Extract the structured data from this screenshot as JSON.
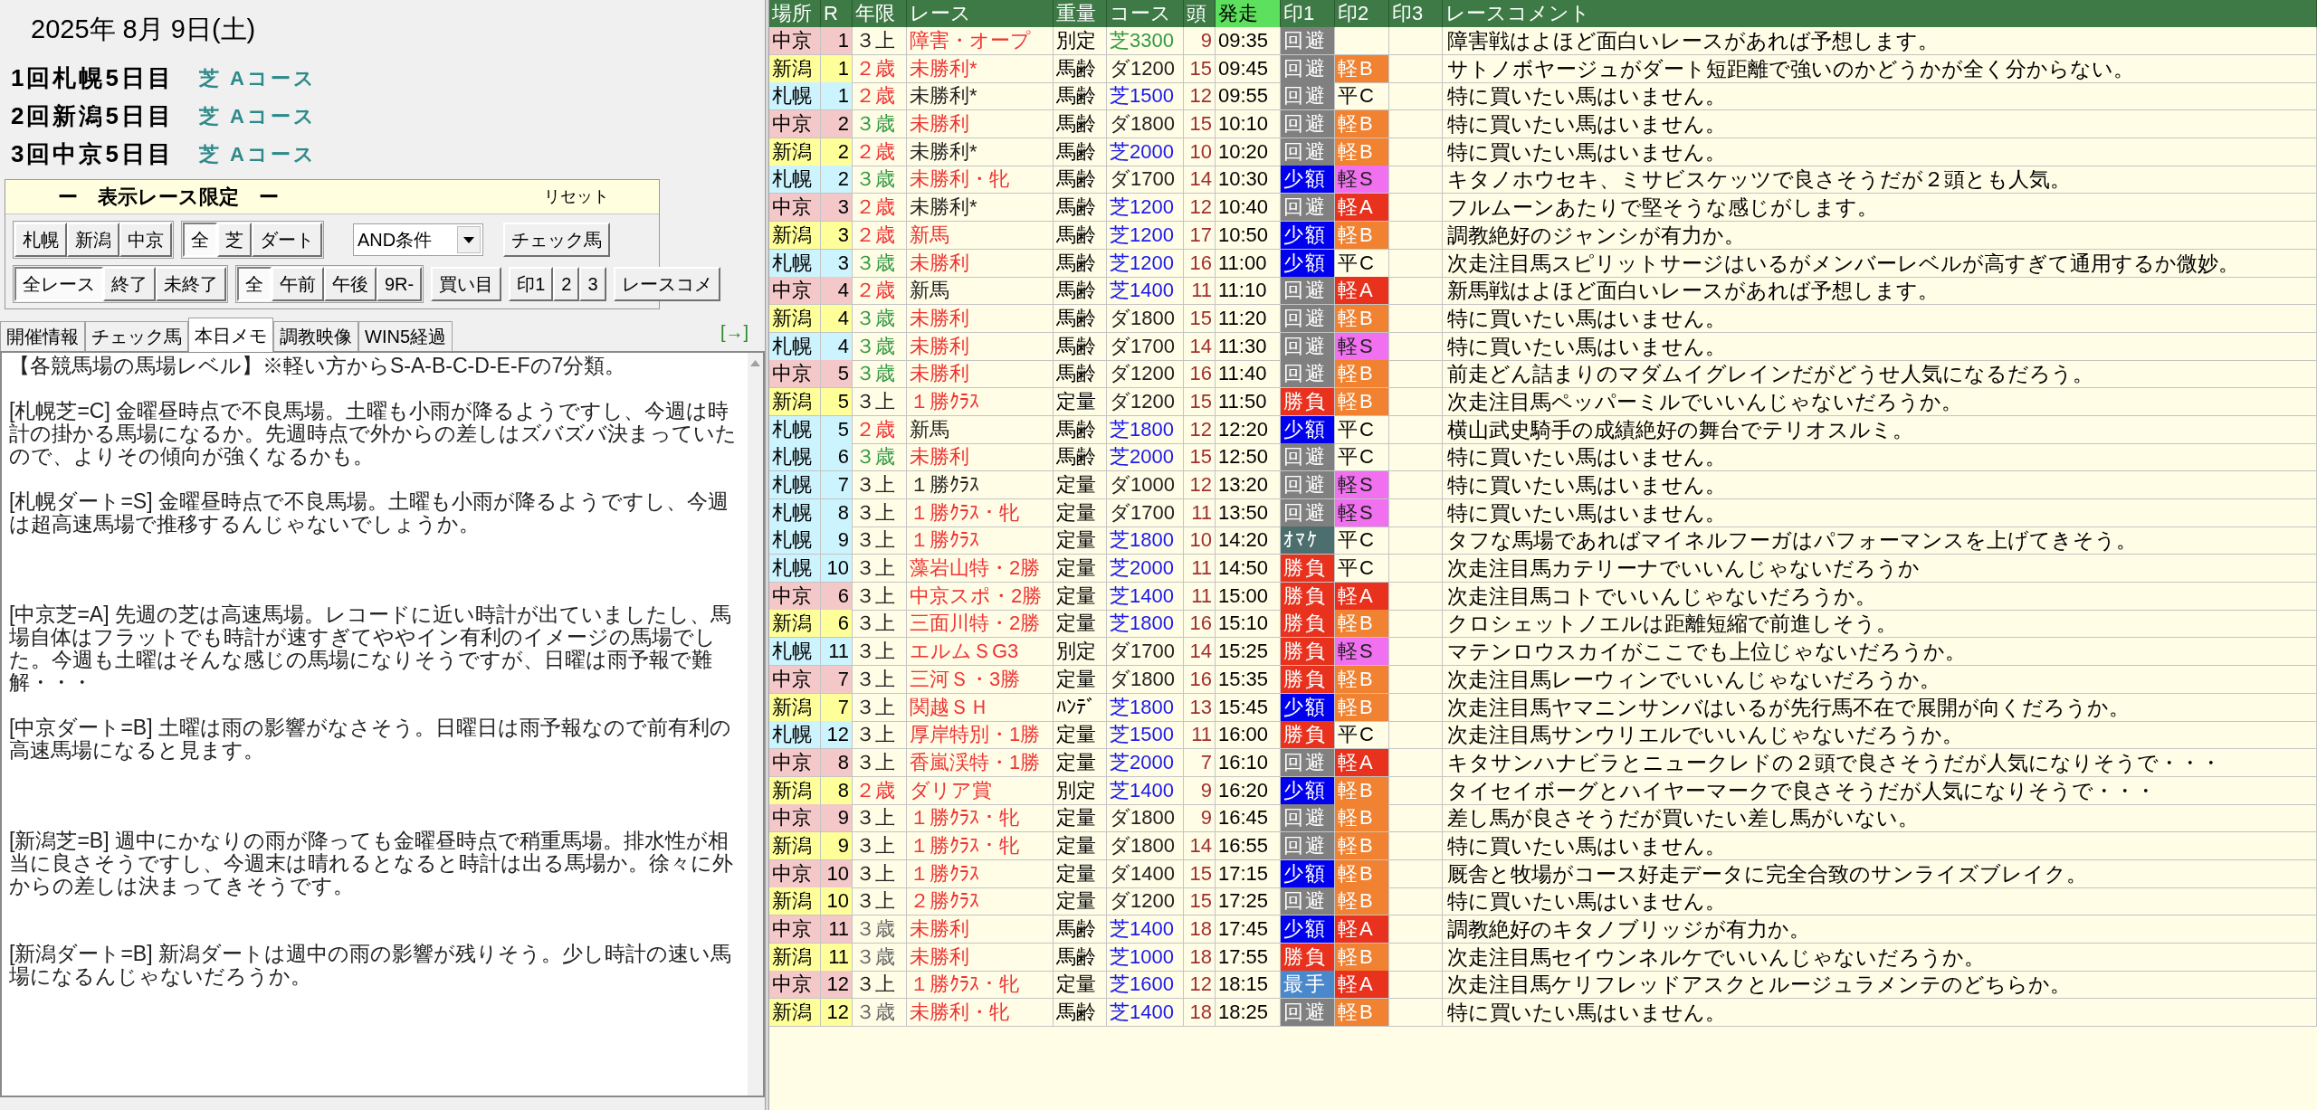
{
  "date": "2025年 8月 9日(土)",
  "meetings": [
    {
      "name": "1回札幌5日目",
      "course": "芝 Aコース"
    },
    {
      "name": "2回新潟5日目",
      "course": "芝 Aコース"
    },
    {
      "name": "3回中京5日目",
      "course": "芝 Aコース"
    }
  ],
  "filter": {
    "title": "ー　表示レース限定　ー",
    "reset": "リセット",
    "venue_buttons": [
      {
        "label": "札幌",
        "selected": false
      },
      {
        "label": "新潟",
        "selected": false
      },
      {
        "label": "中京",
        "selected": false
      }
    ],
    "surface_buttons": [
      {
        "label": "全",
        "selected": true
      },
      {
        "label": "芝",
        "selected": false
      },
      {
        "label": "ダート",
        "selected": false
      }
    ],
    "condition": "AND条件",
    "check_button": "チェック馬",
    "status_buttons": [
      {
        "label": "全レース",
        "selected": true
      },
      {
        "label": "終了",
        "selected": false
      },
      {
        "label": "未終了",
        "selected": false
      }
    ],
    "time_buttons": [
      {
        "label": "全",
        "selected": true
      },
      {
        "label": "午前",
        "selected": false
      },
      {
        "label": "午後",
        "selected": false
      },
      {
        "label": "9R-",
        "selected": false
      }
    ],
    "buy_button": "買い目",
    "mark_buttons": [
      "印1",
      "2",
      "3"
    ],
    "comment_button": "レースコメ"
  },
  "tabs": [
    {
      "label": "開催情報",
      "selected": false
    },
    {
      "label": "チェック馬",
      "selected": false
    },
    {
      "label": "本日メモ",
      "selected": true
    },
    {
      "label": "調教映像",
      "selected": false
    },
    {
      "label": "WIN5経過",
      "selected": false
    }
  ],
  "expand_link": "[→]",
  "memo": "【各競馬場の馬場レベル】※軽い方からS-A-B-C-D-E-Fの7分類。\n\n[札幌芝=C] 金曜昼時点で不良馬場。土曜も小雨が降るようですし、今週は時計の掛かる馬場になるか。先週時点で外からの差しはズバズバ決まっていたので、よりその傾向が強くなるかも。\n\n[札幌ダート=S] 金曜昼時点で不良馬場。土曜も小雨が降るようですし、今週は超高速馬場で推移するんじゃないでしょうか。\n\n\n\n[中京芝=A] 先週の芝は高速馬場。レコードに近い時計が出ていましたし、馬場自体はフラットでも時計が速すぎてややイン有利のイメージの馬場でした。今週も土曜はそんな感じの馬場になりそうですが、日曜は雨予報で難解・・・\n\n[中京ダート=B] 土曜は雨の影響がなさそう。日曜日は雨予報なので前有利の高速馬場になると見ます。\n\n\n\n[新潟芝=B] 週中にかなりの雨が降っても金曜昼時点で稍重馬場。排水性が相当に良さそうですし、今週末は晴れるとなると時計は出る馬場か。徐々に外からの差しは決まってきそうです。\n\n\n[新潟ダート=B] 新潟ダートは週中の雨の影響が残りそう。少し時計の速い馬場になるんじゃないだろうか。",
  "table": {
    "columns": [
      {
        "label": "場所",
        "highlighted": false
      },
      {
        "label": "R",
        "highlighted": false
      },
      {
        "label": "年限",
        "highlighted": false
      },
      {
        "label": "レース",
        "highlighted": false
      },
      {
        "label": "重量",
        "highlighted": false
      },
      {
        "label": "コース",
        "highlighted": false
      },
      {
        "label": "頭",
        "highlighted": false
      },
      {
        "label": "発走",
        "highlighted": true
      },
      {
        "label": "印1",
        "highlighted": false
      },
      {
        "label": "印2",
        "highlighted": false
      },
      {
        "label": "印3",
        "highlighted": false
      },
      {
        "label": "レースコメント",
        "highlighted": false
      }
    ],
    "rows": [
      {
        "venue": {
          "text": "中京",
          "color": "#f4c8c8"
        },
        "r": "1",
        "age": {
          "text": "３上",
          "color": "#222222"
        },
        "race": {
          "text": "障害・オープ",
          "color": "#ee3333"
        },
        "weight": "別定",
        "course": {
          "text": "芝3300",
          "color": "#339944"
        },
        "heads": "9",
        "start": "09:35",
        "mark1": {
          "text": "回避",
          "color": "#808080"
        },
        "comment": "障害戦はよほど面白いレースがあれば予想します。"
      },
      {
        "venue": {
          "text": "新潟",
          "color": "#ffff99"
        },
        "r": "1",
        "age": {
          "text": "２歳",
          "color": "#ee3333"
        },
        "race": {
          "text": "未勝利*",
          "color": "#ee3333"
        },
        "weight": "馬齢",
        "course": {
          "text": "ダ1200",
          "color": "#222222"
        },
        "heads": "15",
        "start": "09:45",
        "mark1": {
          "text": "回避",
          "color": "#808080"
        },
        "mark2": {
          "text": "軽B",
          "color": "#f08232"
        },
        "comment": "サトノボヤージュがダート短距離で強いのかどうかが全く分からない。"
      },
      {
        "venue": {
          "text": "札幌",
          "color": "#ccf4ff"
        },
        "r": "1",
        "age": {
          "text": "２歳",
          "color": "#ee3333"
        },
        "race": {
          "text": "未勝利*",
          "color": "#222222"
        },
        "weight": "馬齢",
        "course": {
          "text": "芝1500",
          "color": "#1a1aee"
        },
        "heads": "12",
        "start": "09:55",
        "mark1": {
          "text": "回避",
          "color": "#808080"
        },
        "mark2": {
          "text": "平C"
        },
        "comment": "特に買いたい馬はいません。"
      },
      {
        "venue": {
          "text": "中京",
          "color": "#f4c8c8"
        },
        "r": "2",
        "age": {
          "text": "３歳",
          "color": "#339944"
        },
        "race": {
          "text": "未勝利",
          "color": "#ee3333"
        },
        "weight": "馬齢",
        "course": {
          "text": "ダ1800",
          "color": "#222222"
        },
        "heads": "15",
        "start": "10:10",
        "mark1": {
          "text": "回避",
          "color": "#808080"
        },
        "mark2": {
          "text": "軽B",
          "color": "#f08232"
        },
        "comment": "特に買いたい馬はいません。"
      },
      {
        "venue": {
          "text": "新潟",
          "color": "#ffff99"
        },
        "r": "2",
        "age": {
          "text": "２歳",
          "color": "#ee3333"
        },
        "race": {
          "text": "未勝利*",
          "color": "#222222"
        },
        "weight": "馬齢",
        "course": {
          "text": "芝2000",
          "color": "#1a1aee"
        },
        "heads": "10",
        "start": "10:20",
        "mark1": {
          "text": "回避",
          "color": "#808080"
        },
        "mark2": {
          "text": "軽B",
          "color": "#f08232"
        },
        "comment": "特に買いたい馬はいません。"
      },
      {
        "venue": {
          "text": "札幌",
          "color": "#ccf4ff"
        },
        "r": "2",
        "age": {
          "text": "３歳",
          "color": "#339944"
        },
        "race": {
          "text": "未勝利・牝",
          "color": "#ee3333"
        },
        "weight": "馬齢",
        "course": {
          "text": "ダ1700",
          "color": "#222222"
        },
        "heads": "14",
        "start": "10:30",
        "mark1": {
          "text": "少額",
          "color": "#0000ee"
        },
        "mark2": {
          "text": "軽S",
          "color": "#f070f0"
        },
        "comment": "キタノホウセキ、ミサビスケッツで良さそうだが２頭とも人気。"
      },
      {
        "venue": {
          "text": "中京",
          "color": "#f4c8c8"
        },
        "r": "3",
        "age": {
          "text": "２歳",
          "color": "#ee3333"
        },
        "race": {
          "text": "未勝利*",
          "color": "#222222"
        },
        "weight": "馬齢",
        "course": {
          "text": "芝1200",
          "color": "#1a1aee"
        },
        "heads": "12",
        "start": "10:40",
        "mark1": {
          "text": "回避",
          "color": "#808080"
        },
        "mark2": {
          "text": "軽A",
          "color": "#e8321e"
        },
        "comment": "フルムーンあたりで堅そうな感じがします。"
      },
      {
        "venue": {
          "text": "新潟",
          "color": "#ffff99"
        },
        "r": "3",
        "age": {
          "text": "２歳",
          "color": "#ee3333"
        },
        "race": {
          "text": "新馬",
          "color": "#ee3333"
        },
        "weight": "馬齢",
        "course": {
          "text": "芝1200",
          "color": "#1a1aee"
        },
        "heads": "17",
        "start": "10:50",
        "mark1": {
          "text": "少額",
          "color": "#0000ee"
        },
        "mark2": {
          "text": "軽B",
          "color": "#f08232"
        },
        "comment": "調教絶好のジャンシが有力か。"
      },
      {
        "venue": {
          "text": "札幌",
          "color": "#ccf4ff"
        },
        "r": "3",
        "age": {
          "text": "３歳",
          "color": "#339944"
        },
        "race": {
          "text": "未勝利",
          "color": "#ee3333"
        },
        "weight": "馬齢",
        "course": {
          "text": "芝1200",
          "color": "#1a1aee"
        },
        "heads": "16",
        "start": "11:00",
        "mark1": {
          "text": "少額",
          "color": "#0000ee"
        },
        "mark2": {
          "text": "平C"
        },
        "comment": "次走注目馬スピリットサージはいるがメンバーレベルが高すぎて通用するか微妙。"
      },
      {
        "venue": {
          "text": "中京",
          "color": "#f4c8c8"
        },
        "r": "4",
        "age": {
          "text": "２歳",
          "color": "#ee3333"
        },
        "race": {
          "text": "新馬",
          "color": "#222222"
        },
        "weight": "馬齢",
        "course": {
          "text": "芝1400",
          "color": "#1a1aee"
        },
        "heads": "11",
        "start": "11:10",
        "mark1": {
          "text": "回避",
          "color": "#808080"
        },
        "mark2": {
          "text": "軽A",
          "color": "#e8321e"
        },
        "comment": "新馬戦はよほど面白いレースがあれば予想します。"
      },
      {
        "venue": {
          "text": "新潟",
          "color": "#ffff99"
        },
        "r": "4",
        "age": {
          "text": "３歳",
          "color": "#339944"
        },
        "race": {
          "text": "未勝利",
          "color": "#ee3333"
        },
        "weight": "馬齢",
        "course": {
          "text": "ダ1800",
          "color": "#222222"
        },
        "heads": "15",
        "start": "11:20",
        "mark1": {
          "text": "回避",
          "color": "#808080"
        },
        "mark2": {
          "text": "軽B",
          "color": "#f08232"
        },
        "comment": "特に買いたい馬はいません。"
      },
      {
        "venue": {
          "text": "札幌",
          "color": "#ccf4ff"
        },
        "r": "4",
        "age": {
          "text": "３歳",
          "color": "#339944"
        },
        "race": {
          "text": "未勝利",
          "color": "#ee3333"
        },
        "weight": "馬齢",
        "course": {
          "text": "ダ1700",
          "color": "#222222"
        },
        "heads": "14",
        "start": "11:30",
        "mark1": {
          "text": "回避",
          "color": "#808080"
        },
        "mark2": {
          "text": "軽S",
          "color": "#f070f0"
        },
        "comment": "特に買いたい馬はいません。"
      },
      {
        "venue": {
          "text": "中京",
          "color": "#f4c8c8"
        },
        "r": "5",
        "age": {
          "text": "３歳",
          "color": "#339944"
        },
        "race": {
          "text": "未勝利",
          "color": "#ee3333"
        },
        "weight": "馬齢",
        "course": {
          "text": "ダ1200",
          "color": "#222222"
        },
        "heads": "16",
        "start": "11:40",
        "mark1": {
          "text": "回避",
          "color": "#808080"
        },
        "mark2": {
          "text": "軽B",
          "color": "#f08232"
        },
        "comment": "前走どん詰まりのマダムイグレインだがどうせ人気になるだろう。"
      },
      {
        "venue": {
          "text": "新潟",
          "color": "#ffff99"
        },
        "r": "5",
        "age": {
          "text": "３上",
          "color": "#222222"
        },
        "race": {
          "text": "１勝ｸﾗｽ",
          "color": "#ee3333"
        },
        "weight": "定量",
        "course": {
          "text": "ダ1200",
          "color": "#222222"
        },
        "heads": "15",
        "start": "11:50",
        "mark1": {
          "text": "勝負",
          "color": "#e8321e"
        },
        "mark2": {
          "text": "軽B",
          "color": "#f08232"
        },
        "comment": "次走注目馬ペッパーミルでいいんじゃないだろうか。"
      },
      {
        "venue": {
          "text": "札幌",
          "color": "#ccf4ff"
        },
        "r": "5",
        "age": {
          "text": "２歳",
          "color": "#ee3333"
        },
        "race": {
          "text": "新馬",
          "color": "#222222"
        },
        "weight": "馬齢",
        "course": {
          "text": "芝1800",
          "color": "#1a1aee"
        },
        "heads": "12",
        "start": "12:20",
        "mark1": {
          "text": "少額",
          "color": "#0000ee"
        },
        "mark2": {
          "text": "平C"
        },
        "comment": "横山武史騎手の成績絶好の舞台でテリオスルミ。"
      },
      {
        "venue": {
          "text": "札幌",
          "color": "#ccf4ff"
        },
        "r": "6",
        "age": {
          "text": "３歳",
          "color": "#339944"
        },
        "race": {
          "text": "未勝利",
          "color": "#ee3333"
        },
        "weight": "馬齢",
        "course": {
          "text": "芝2000",
          "color": "#1a1aee"
        },
        "heads": "15",
        "start": "12:50",
        "mark1": {
          "text": "回避",
          "color": "#808080"
        },
        "mark2": {
          "text": "平C"
        },
        "comment": "特に買いたい馬はいません。"
      },
      {
        "venue": {
          "text": "札幌",
          "color": "#ccf4ff"
        },
        "r": "7",
        "age": {
          "text": "３上",
          "color": "#222222"
        },
        "race": {
          "text": "１勝ｸﾗｽ",
          "color": "#222222"
        },
        "weight": "定量",
        "course": {
          "text": "ダ1000",
          "color": "#222222"
        },
        "heads": "12",
        "start": "13:20",
        "mark1": {
          "text": "回避",
          "color": "#808080"
        },
        "mark2": {
          "text": "軽S",
          "color": "#f070f0"
        },
        "comment": "特に買いたい馬はいません。"
      },
      {
        "venue": {
          "text": "札幌",
          "color": "#ccf4ff"
        },
        "r": "8",
        "age": {
          "text": "３上",
          "color": "#222222"
        },
        "race": {
          "text": "１勝ｸﾗｽ・牝",
          "color": "#ee3333"
        },
        "weight": "定量",
        "course": {
          "text": "ダ1700",
          "color": "#222222"
        },
        "heads": "11",
        "start": "13:50",
        "mark1": {
          "text": "回避",
          "color": "#808080"
        },
        "mark2": {
          "text": "軽S",
          "color": "#f070f0"
        },
        "comment": "特に買いたい馬はいません。"
      },
      {
        "venue": {
          "text": "札幌",
          "color": "#ccf4ff"
        },
        "r": "9",
        "age": {
          "text": "３上",
          "color": "#222222"
        },
        "race": {
          "text": "１勝ｸﾗｽ",
          "color": "#ee3333"
        },
        "weight": "定量",
        "course": {
          "text": "芝1800",
          "color": "#1a1aee"
        },
        "heads": "10",
        "start": "14:20",
        "mark1": {
          "text": "ｵﾏｹ",
          "color": "#4d6e6e"
        },
        "mark2": {
          "text": "平C"
        },
        "comment": "タフな馬場であればマイネルフーガはパフォーマンスを上げてきそう。"
      },
      {
        "venue": {
          "text": "札幌",
          "color": "#ccf4ff"
        },
        "r": "10",
        "age": {
          "text": "３上",
          "color": "#222222"
        },
        "race": {
          "text": "藻岩山特・2勝",
          "color": "#ee3333"
        },
        "weight": "定量",
        "course": {
          "text": "芝2000",
          "color": "#1a1aee"
        },
        "heads": "11",
        "start": "14:50",
        "mark1": {
          "text": "勝負",
          "color": "#e8321e"
        },
        "mark2": {
          "text": "平C"
        },
        "comment": "次走注目馬カテリーナでいいんじゃないだろうか"
      },
      {
        "venue": {
          "text": "中京",
          "color": "#f4c8c8"
        },
        "r": "6",
        "age": {
          "text": "３上",
          "color": "#222222"
        },
        "race": {
          "text": "中京スポ・2勝",
          "color": "#ee3333"
        },
        "weight": "定量",
        "course": {
          "text": "芝1400",
          "color": "#1a1aee"
        },
        "heads": "11",
        "start": "15:00",
        "mark1": {
          "text": "勝負",
          "color": "#e8321e"
        },
        "mark2": {
          "text": "軽A",
          "color": "#e8321e"
        },
        "comment": "次走注目馬コトでいいんじゃないだろうか。"
      },
      {
        "venue": {
          "text": "新潟",
          "color": "#ffff99"
        },
        "r": "6",
        "age": {
          "text": "３上",
          "color": "#222222"
        },
        "race": {
          "text": "三面川特・2勝",
          "color": "#ee3333"
        },
        "weight": "定量",
        "course": {
          "text": "芝1800",
          "color": "#1a1aee"
        },
        "heads": "16",
        "start": "15:10",
        "mark1": {
          "text": "勝負",
          "color": "#e8321e"
        },
        "mark2": {
          "text": "軽B",
          "color": "#f08232"
        },
        "comment": "クロシェットノエルは距離短縮で前進しそう。"
      },
      {
        "venue": {
          "text": "札幌",
          "color": "#ccf4ff"
        },
        "r": "11",
        "age": {
          "text": "３上",
          "color": "#222222"
        },
        "race": {
          "text": "エルムＳG3",
          "color": "#ee3333"
        },
        "weight": "別定",
        "course": {
          "text": "ダ1700",
          "color": "#222222"
        },
        "heads": "14",
        "start": "15:25",
        "mark1": {
          "text": "勝負",
          "color": "#e8321e"
        },
        "mark2": {
          "text": "軽S",
          "color": "#f070f0"
        },
        "comment": "マテンロウスカイがここでも上位じゃないだろうか。"
      },
      {
        "venue": {
          "text": "中京",
          "color": "#f4c8c8"
        },
        "r": "7",
        "age": {
          "text": "３上",
          "color": "#222222"
        },
        "race": {
          "text": "三河Ｓ・3勝",
          "color": "#ee3333"
        },
        "weight": "定量",
        "course": {
          "text": "ダ1800",
          "color": "#222222"
        },
        "heads": "16",
        "start": "15:35",
        "mark1": {
          "text": "勝負",
          "color": "#e8321e"
        },
        "mark2": {
          "text": "軽B",
          "color": "#f08232"
        },
        "comment": "次走注目馬レーウィンでいいんじゃないだろうか。"
      },
      {
        "venue": {
          "text": "新潟",
          "color": "#ffff99"
        },
        "r": "7",
        "age": {
          "text": "３上",
          "color": "#222222"
        },
        "race": {
          "text": "関越ＳＨ",
          "color": "#ee3333"
        },
        "weight": "ﾊﾝﾃﾞ",
        "course": {
          "text": "芝1800",
          "color": "#1a1aee"
        },
        "heads": "13",
        "start": "15:45",
        "mark1": {
          "text": "少額",
          "color": "#0000ee"
        },
        "mark2": {
          "text": "軽B",
          "color": "#f08232"
        },
        "comment": "次走注目馬ヤマニンサンバはいるが先行馬不在で展開が向くだろうか。"
      },
      {
        "venue": {
          "text": "札幌",
          "color": "#ccf4ff"
        },
        "r": "12",
        "age": {
          "text": "３上",
          "color": "#222222"
        },
        "race": {
          "text": "厚岸特別・1勝",
          "color": "#ee3333"
        },
        "weight": "定量",
        "course": {
          "text": "芝1500",
          "color": "#1a1aee"
        },
        "heads": "11",
        "start": "16:00",
        "mark1": {
          "text": "勝負",
          "color": "#e8321e"
        },
        "mark2": {
          "text": "平C"
        },
        "comment": "次走注目馬サンウリエルでいいんじゃないだろうか。"
      },
      {
        "venue": {
          "text": "中京",
          "color": "#f4c8c8"
        },
        "r": "8",
        "age": {
          "text": "３上",
          "color": "#222222"
        },
        "race": {
          "text": "香嵐渓特・1勝",
          "color": "#ee3333"
        },
        "weight": "定量",
        "course": {
          "text": "芝2000",
          "color": "#1a1aee"
        },
        "heads": "7",
        "start": "16:10",
        "mark1": {
          "text": "回避",
          "color": "#808080"
        },
        "mark2": {
          "text": "軽A",
          "color": "#e8321e"
        },
        "comment": "キタサンハナビラとニュークレドの２頭で良さそうだが人気になりそうで・・・"
      },
      {
        "venue": {
          "text": "新潟",
          "color": "#ffff99"
        },
        "r": "8",
        "age": {
          "text": "２歳",
          "color": "#ee3333"
        },
        "race": {
          "text": "ダリア賞",
          "color": "#ee3333"
        },
        "weight": "別定",
        "course": {
          "text": "芝1400",
          "color": "#1a1aee"
        },
        "heads": "9",
        "start": "16:20",
        "mark1": {
          "text": "少額",
          "color": "#0000ee"
        },
        "mark2": {
          "text": "軽B",
          "color": "#f08232"
        },
        "comment": "タイセイボーグとハイヤーマークで良さそうだが人気になりそうで・・・"
      },
      {
        "venue": {
          "text": "中京",
          "color": "#f4c8c8"
        },
        "r": "9",
        "age": {
          "text": "３上",
          "color": "#222222"
        },
        "race": {
          "text": "１勝ｸﾗｽ・牝",
          "color": "#ee3333"
        },
        "weight": "定量",
        "course": {
          "text": "ダ1800",
          "color": "#222222"
        },
        "heads": "9",
        "start": "16:45",
        "mark1": {
          "text": "回避",
          "color": "#808080"
        },
        "mark2": {
          "text": "軽B",
          "color": "#f08232"
        },
        "comment": "差し馬が良さそうだが買いたい差し馬がいない。"
      },
      {
        "venue": {
          "text": "新潟",
          "color": "#ffff99"
        },
        "r": "9",
        "age": {
          "text": "３上",
          "color": "#222222"
        },
        "race": {
          "text": "１勝ｸﾗｽ・牝",
          "color": "#ee3333"
        },
        "weight": "定量",
        "course": {
          "text": "ダ1800",
          "color": "#222222"
        },
        "heads": "14",
        "start": "16:55",
        "mark1": {
          "text": "回避",
          "color": "#808080"
        },
        "mark2": {
          "text": "軽B",
          "color": "#f08232"
        },
        "comment": "特に買いたい馬はいません。"
      },
      {
        "venue": {
          "text": "中京",
          "color": "#f4c8c8"
        },
        "r": "10",
        "age": {
          "text": "３上",
          "color": "#222222"
        },
        "race": {
          "text": "１勝ｸﾗｽ",
          "color": "#ee3333"
        },
        "weight": "定量",
        "course": {
          "text": "ダ1400",
          "color": "#222222"
        },
        "heads": "15",
        "start": "17:15",
        "mark1": {
          "text": "少額",
          "color": "#0000ee"
        },
        "mark2": {
          "text": "軽B",
          "color": "#f08232"
        },
        "comment": "厩舎と牧場がコース好走データに完全合致のサンライズブレイク。"
      },
      {
        "venue": {
          "text": "新潟",
          "color": "#ffff99"
        },
        "r": "10",
        "age": {
          "text": "３上",
          "color": "#222222"
        },
        "race": {
          "text": "２勝ｸﾗｽ",
          "color": "#ee3333"
        },
        "weight": "定量",
        "course": {
          "text": "ダ1200",
          "color": "#222222"
        },
        "heads": "15",
        "start": "17:25",
        "mark1": {
          "text": "回避",
          "color": "#808080"
        },
        "mark2": {
          "text": "軽B",
          "color": "#f08232"
        },
        "comment": "特に買いたい馬はいません。"
      },
      {
        "venue": {
          "text": "中京",
          "color": "#f4c8c8"
        },
        "r": "11",
        "age": {
          "text": "３歳",
          "color": "#666666"
        },
        "race": {
          "text": "未勝利",
          "color": "#ee3333"
        },
        "weight": "馬齢",
        "course": {
          "text": "芝1400",
          "color": "#1a1aee"
        },
        "heads": "18",
        "start": "17:45",
        "mark1": {
          "text": "少額",
          "color": "#0000ee"
        },
        "mark2": {
          "text": "軽A",
          "color": "#e8321e"
        },
        "comment": "調教絶好のキタノブリッジが有力か。"
      },
      {
        "venue": {
          "text": "新潟",
          "color": "#ffff99"
        },
        "r": "11",
        "age": {
          "text": "３歳",
          "color": "#666666"
        },
        "race": {
          "text": "未勝利",
          "color": "#ee3333"
        },
        "weight": "馬齢",
        "course": {
          "text": "芝1000",
          "color": "#1a1aee"
        },
        "heads": "18",
        "start": "17:55",
        "mark1": {
          "text": "勝負",
          "color": "#e8321e"
        },
        "mark2": {
          "text": "軽B",
          "color": "#f08232"
        },
        "comment": "次走注目馬セイウンネルケでいいんじゃないだろうか。"
      },
      {
        "venue": {
          "text": "中京",
          "color": "#f4c8c8"
        },
        "r": "12",
        "age": {
          "text": "３上",
          "color": "#222222"
        },
        "race": {
          "text": "１勝ｸﾗｽ・牝",
          "color": "#ee3333"
        },
        "weight": "定量",
        "course": {
          "text": "芝1600",
          "color": "#1a1aee"
        },
        "heads": "12",
        "start": "18:15",
        "mark1": {
          "text": "最手",
          "color": "#4a88cc"
        },
        "mark2": {
          "text": "軽A",
          "color": "#e8321e"
        },
        "comment": "次走注目馬ケリフレッドアスクとルージュラメンテのどちらか。"
      },
      {
        "venue": {
          "text": "新潟",
          "color": "#ffff99"
        },
        "r": "12",
        "age": {
          "text": "３歳",
          "color": "#666666"
        },
        "race": {
          "text": "未勝利・牝",
          "color": "#ee3333"
        },
        "weight": "馬齢",
        "course": {
          "text": "芝1400",
          "color": "#1a1aee"
        },
        "heads": "18",
        "start": "18:25",
        "mark1": {
          "text": "回避",
          "color": "#808080"
        },
        "mark2": {
          "text": "軽B",
          "color": "#f08232"
        },
        "comment": "特に買いたい馬はいません。"
      }
    ]
  }
}
